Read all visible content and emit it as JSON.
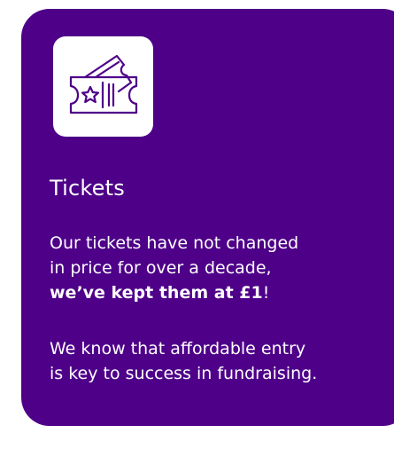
{
  "card": {
    "title": "Tickets",
    "paragraph1": {
      "line1": "Our tickets have not changed",
      "line2": "in price for over a decade,",
      "bold": "we’ve kept them at £1",
      "suffix": "!"
    },
    "paragraph2": {
      "line1": "We know that affordable entry",
      "line2": "is key to success in fundraising."
    },
    "icon": "ticket-icon"
  },
  "colors": {
    "card_background": "#4e0089",
    "icon_tile": "#ffffff",
    "icon_stroke": "#4e0089",
    "text": "#ffffff"
  }
}
